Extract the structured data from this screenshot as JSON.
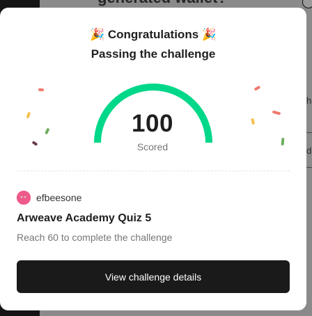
{
  "background": {
    "title": "generated wallet?",
    "cut_text_1": "h",
    "cut_text_2": "d"
  },
  "modal": {
    "title_line1": "🎉 Congratulations 🎉",
    "title_line2": "Passing the challenge",
    "score": {
      "value": "100",
      "label": "Scored",
      "fraction": 1.0,
      "color": "#00d889",
      "max": 100
    },
    "author": {
      "name": "efbeesone",
      "avatar_color": "#ef5a8a"
    },
    "quiz_title": "Arweave Academy Quiz 5",
    "requirement": "Reach 60 to complete the challenge",
    "details_button": "View challenge details"
  },
  "icons": {
    "party_popper": "party-popper-icon",
    "avatar": "avatar-face-icon"
  },
  "colors": {
    "accent": "#00d889",
    "button_bg": "#1a1a1a",
    "confetti": [
      "#f07a6e",
      "#f2c14e",
      "#6fae5f",
      "#6b3a4e"
    ]
  }
}
